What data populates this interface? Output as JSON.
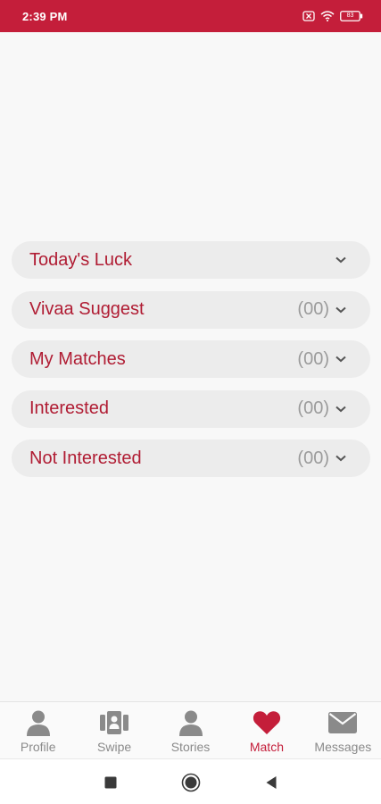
{
  "status_bar": {
    "time": "2:39 PM",
    "battery": "83",
    "icons": [
      "sim-off-icon",
      "wifi-icon",
      "battery-icon"
    ],
    "background": "#c41e3a"
  },
  "match_sections": [
    {
      "label": "Today's Luck",
      "count": ""
    },
    {
      "label": "Vivaa Suggest",
      "count": "(00)"
    },
    {
      "label": "My Matches",
      "count": "(00)"
    },
    {
      "label": "Interested",
      "count": "(00)"
    },
    {
      "label": "Not Interested",
      "count": "(00)"
    }
  ],
  "bottom_nav": {
    "items": [
      {
        "label": "Profile",
        "icon": "person-icon"
      },
      {
        "label": "Swipe",
        "icon": "swipe-cards-icon"
      },
      {
        "label": "Stories",
        "icon": "person-icon"
      },
      {
        "label": "Match",
        "icon": "heart-icon",
        "active": true
      },
      {
        "label": "Messages",
        "icon": "envelope-icon"
      }
    ],
    "active_color": "#c41e3a"
  },
  "system_nav": [
    "recents-square-icon",
    "home-circle-icon",
    "back-triangle-icon"
  ]
}
